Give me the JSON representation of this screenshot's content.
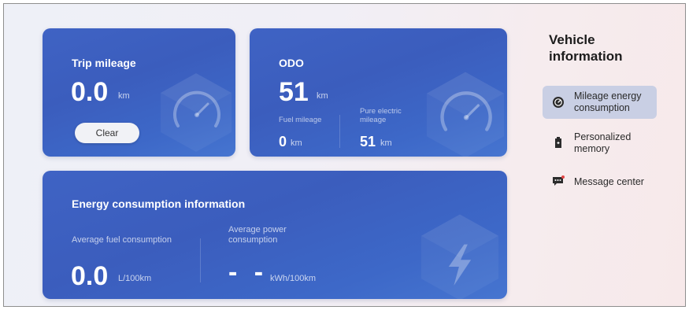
{
  "trip": {
    "title": "Trip mileage",
    "value": "0.0",
    "unit": "km",
    "clear_label": "Clear"
  },
  "odo": {
    "title": "ODO",
    "value": "51",
    "unit": "km",
    "fuel_label": "Fuel mileage",
    "fuel_value": "0",
    "fuel_unit": "km",
    "electric_label": "Pure electric mileage",
    "electric_value": "51",
    "electric_unit": "km"
  },
  "energy": {
    "title": "Energy consumption information",
    "fuel_label": "Average fuel consumption",
    "fuel_value": "0.0",
    "fuel_unit": "L/100km",
    "power_label": "Average power consumption",
    "power_value": "- -",
    "power_unit": "kWh/100km"
  },
  "sidebar": {
    "title": "Vehicle information",
    "items": [
      {
        "label": "Mileage energy consumption",
        "icon": "gauge-icon",
        "active": true
      },
      {
        "label": "Personalized memory",
        "icon": "seat-memory-icon",
        "active": false
      },
      {
        "label": "Message center",
        "icon": "message-icon",
        "active": false
      }
    ]
  },
  "colors": {
    "card": "#3d61c2",
    "active_item": "#c9cfe4"
  }
}
